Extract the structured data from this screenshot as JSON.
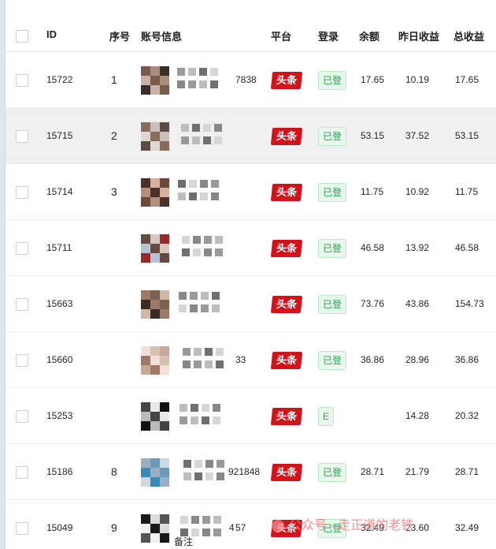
{
  "headers": {
    "id": "ID",
    "seq": "序号",
    "account": "账号信息",
    "platform": "平台",
    "login": "登录",
    "balance": "余额",
    "yesterday": "昨日收益",
    "total": "总收益"
  },
  "rows": [
    {
      "id": "15722",
      "seq": "1",
      "acct_frag": "7838",
      "platform": "头条",
      "login": "已登",
      "balance": "17.65",
      "yesterday": "10.19",
      "total": "17.65"
    },
    {
      "id": "15715",
      "seq": "2",
      "acct_frag": "",
      "platform": "头条",
      "login": "已登",
      "balance": "53.15",
      "yesterday": "37.52",
      "total": "53.15"
    },
    {
      "id": "15714",
      "seq": "3",
      "acct_frag": "",
      "platform": "头条",
      "login": "已登",
      "balance": "11.75",
      "yesterday": "10.92",
      "total": "11.75"
    },
    {
      "id": "15711",
      "seq": "",
      "acct_frag": "",
      "platform": "头条",
      "login": "已登",
      "balance": "46.58",
      "yesterday": "13.92",
      "total": "46.58"
    },
    {
      "id": "15663",
      "seq": "",
      "acct_frag": "",
      "platform": "头条",
      "login": "已登",
      "balance": "73.76",
      "yesterday": "43.86",
      "total": "154.73"
    },
    {
      "id": "15660",
      "seq": "",
      "acct_frag": "33",
      "platform": "头条",
      "login": "已登",
      "balance": "36.86",
      "yesterday": "28.96",
      "total": "36.86"
    },
    {
      "id": "15253",
      "seq": "",
      "acct_frag": "",
      "platform": "头条",
      "login": "E",
      "balance": "",
      "yesterday": "14.28",
      "total": "20.32"
    },
    {
      "id": "15186",
      "seq": "8",
      "acct_frag": "921848",
      "platform": "头条",
      "login": "已登",
      "balance": "28.71",
      "yesterday": "21.79",
      "total": "28.71"
    },
    {
      "id": "15049",
      "seq": "9",
      "acct_frag": "57",
      "acct_frag2": "4",
      "acct_note": "备注",
      "platform": "头条",
      "login": "已登",
      "balance": "32.49",
      "yesterday": "23.60",
      "total": "32.49"
    }
  ],
  "watermark": "公众号 · 走正道的老铁"
}
